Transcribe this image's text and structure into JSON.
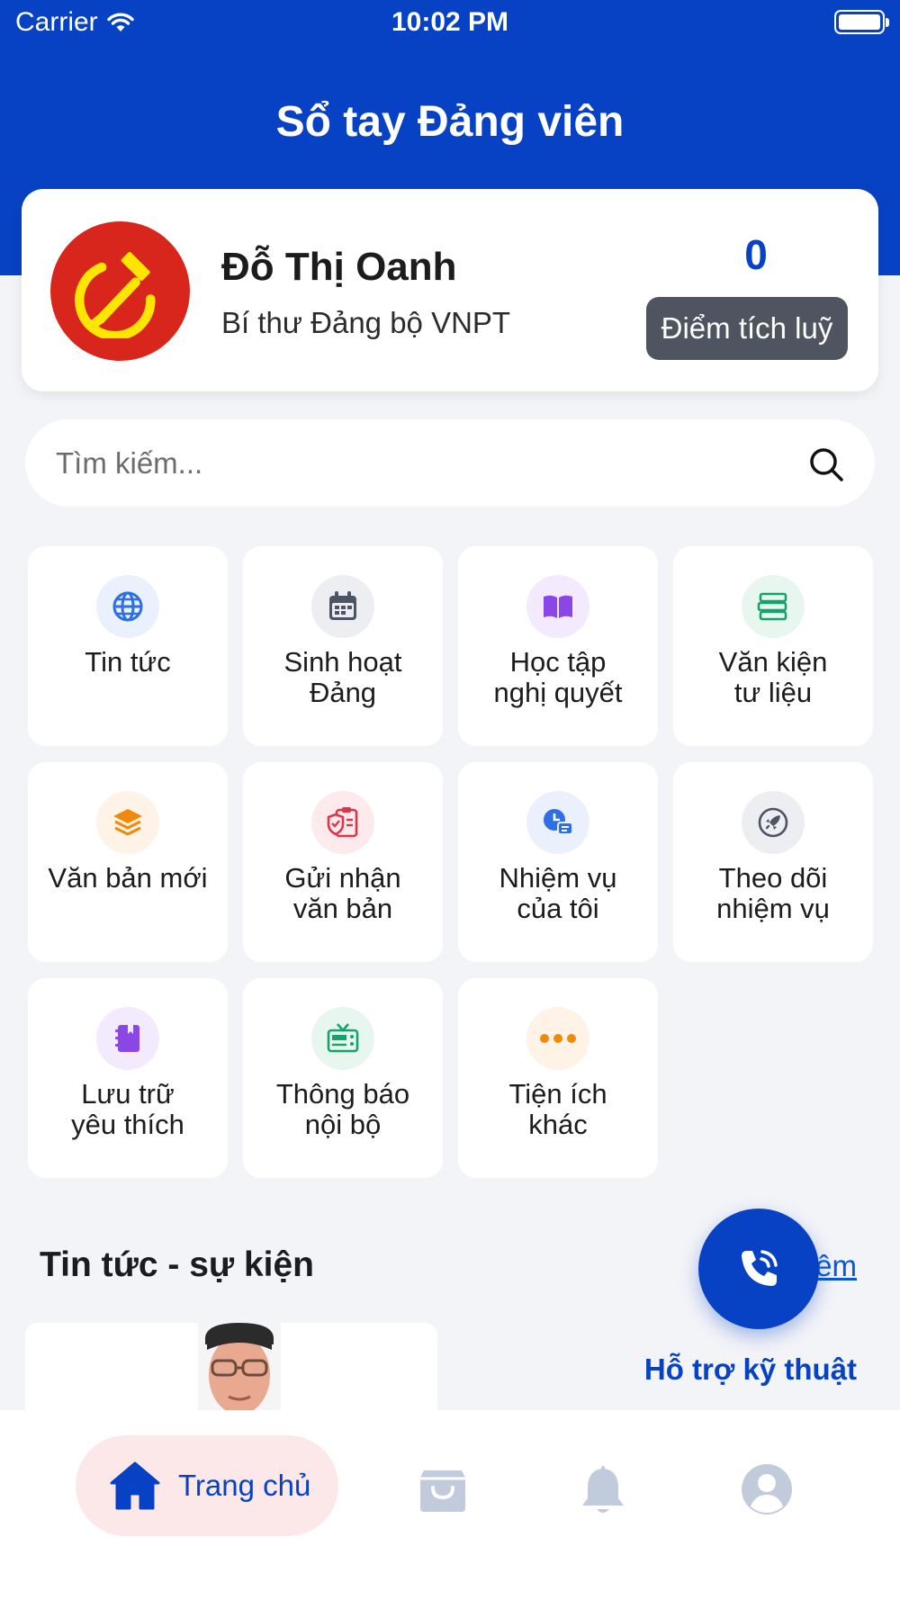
{
  "status_bar": {
    "carrier": "Carrier",
    "time": "10:02 PM"
  },
  "header": {
    "title": "Sổ tay Đảng viên"
  },
  "profile": {
    "name": "Đỗ Thị Oanh",
    "role": "Bí thư Đảng bộ VNPT",
    "points_value": "0",
    "points_button": "Điểm tích luỹ"
  },
  "search": {
    "placeholder": "Tìm kiếm..."
  },
  "menu": {
    "items": [
      {
        "label": "Tin tức",
        "icon": "globe-icon",
        "color": "#2f6fe6",
        "bg": "#eaf1fd"
      },
      {
        "label": "Sinh hoạt\nĐảng",
        "icon": "calendar-icon",
        "color": "#4b5563",
        "bg": "#eceef1"
      },
      {
        "label": "Học tập\nnghị quyết",
        "icon": "book-open-icon",
        "color": "#8b47e6",
        "bg": "#f3ebfd"
      },
      {
        "label": "Văn kiện\ntư liệu",
        "icon": "books-stack-icon",
        "color": "#16a36b",
        "bg": "#e7f7ef"
      },
      {
        "label": "Văn bản mới",
        "icon": "layers-icon",
        "color": "#f08a0c",
        "bg": "#fef3e6"
      },
      {
        "label": "Gửi nhận\nvăn bản",
        "icon": "clipboard-shield-icon",
        "color": "#e0344a",
        "bg": "#fdeaec"
      },
      {
        "label": "Nhiệm vụ\ncủa tôi",
        "icon": "task-chat-icon",
        "color": "#2f6fe6",
        "bg": "#eaf1fd"
      },
      {
        "label": "Theo dõi\nnhiệm vụ",
        "icon": "rocket-icon",
        "color": "#4b5563",
        "bg": "#eceef1"
      },
      {
        "label": "Lưu trữ\nyêu thích",
        "icon": "notebook-icon",
        "color": "#8b47e6",
        "bg": "#f3ebfd"
      },
      {
        "label": "Thông báo\nnội bộ",
        "icon": "news-tv-icon",
        "color": "#16a36b",
        "bg": "#e7f7ef"
      },
      {
        "label": "Tiện ích\nkhác",
        "icon": "more-dots-icon",
        "color": "#f08a0c",
        "bg": "#fef3e6"
      }
    ]
  },
  "news": {
    "section_title": "Tin tức - sự kiện",
    "more_link": "êm"
  },
  "support": {
    "label": "Hỗ trợ kỹ thuật"
  },
  "tab_bar": {
    "home_label": "Trang chủ",
    "active_color": "#0842c4",
    "inactive_color": "#c2cbdb"
  }
}
